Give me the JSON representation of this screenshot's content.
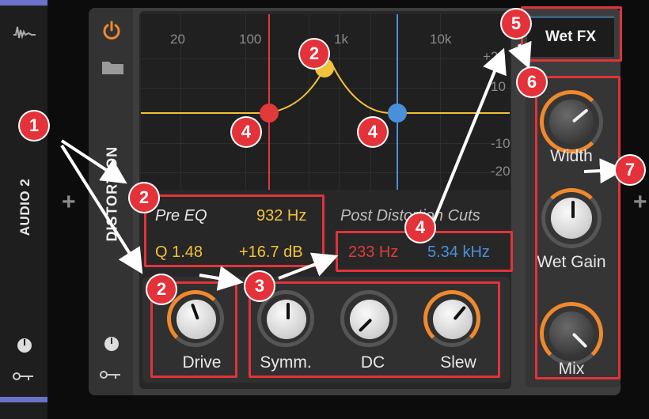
{
  "track": {
    "name": "AUDIO 2"
  },
  "device": {
    "name": "DISTORTION"
  },
  "graph": {
    "freq_labels": [
      "20",
      "100",
      "1k",
      "10k"
    ],
    "db_labels": [
      "+20",
      "10",
      "-10",
      "-20"
    ]
  },
  "pre_eq": {
    "title": "Pre EQ",
    "freq": "932 Hz",
    "q": "Q 1.48",
    "gain": "+16.7 dB"
  },
  "post_cuts": {
    "title": "Post Distortion Cuts",
    "low": "233 Hz",
    "high": "5.34 kHz"
  },
  "knobs": {
    "drive": "Drive",
    "symm": "Symm.",
    "dc": "DC",
    "slew": "Slew"
  },
  "wet": {
    "title": "Wet FX",
    "width": "Width",
    "gain": "Wet Gain",
    "mix": "Mix"
  },
  "annotations": [
    "1",
    "2",
    "3",
    "4",
    "5",
    "6",
    "7"
  ],
  "colors": {
    "accent": "#f0892d",
    "low_cut": "#e23a3a",
    "high_cut": "#4a90d9",
    "peak": "#f2c23a",
    "annotation": "#e4323a"
  }
}
